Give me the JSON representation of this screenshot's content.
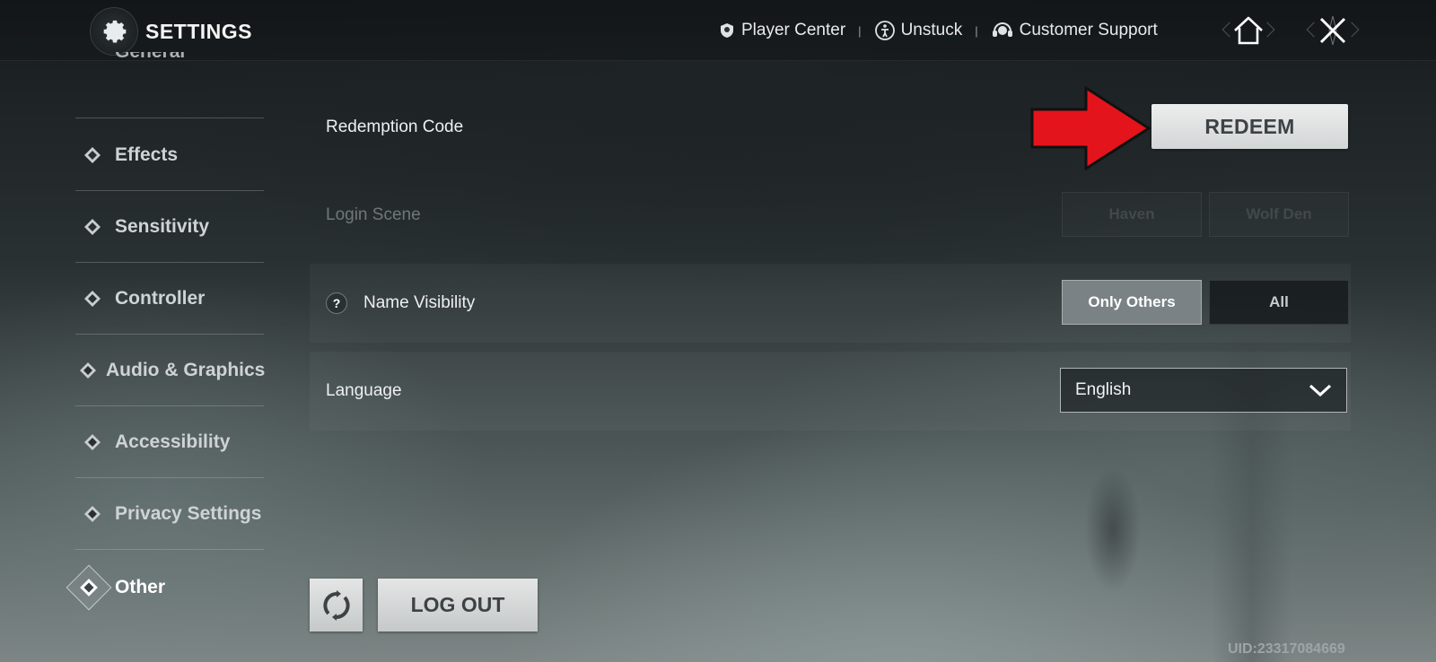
{
  "header": {
    "title": "SETTINGS",
    "links": [
      {
        "label": "Player Center",
        "icon": "player-center-icon"
      },
      {
        "label": "Unstuck",
        "icon": "unstuck-icon"
      },
      {
        "label": "Customer Support",
        "icon": "headset-icon"
      }
    ],
    "separator": "|"
  },
  "sidebar": {
    "items": [
      {
        "label": "General"
      },
      {
        "label": "Effects"
      },
      {
        "label": "Sensitivity"
      },
      {
        "label": "Controller"
      },
      {
        "label": "Audio & Graphics"
      },
      {
        "label": "Accessibility"
      },
      {
        "label": "Privacy Settings"
      },
      {
        "label": "Other",
        "active": true
      }
    ]
  },
  "main": {
    "redemption": {
      "label": "Redemption Code",
      "button": "REDEEM"
    },
    "login_scene": {
      "label": "Login Scene",
      "options": [
        "Haven",
        "Wolf Den"
      ],
      "enabled": false
    },
    "name_visibility": {
      "label": "Name Visibility",
      "help": "?",
      "options": [
        "Only Others",
        "All"
      ],
      "selected": "Only Others"
    },
    "language": {
      "label": "Language",
      "value": "English"
    }
  },
  "footer": {
    "logout": "LOG OUT",
    "uid": "UID:23317084669"
  },
  "colors": {
    "arrow": "#e4141c",
    "button_bg": "#e0e2e2",
    "selected_segment": "#7a8285"
  }
}
